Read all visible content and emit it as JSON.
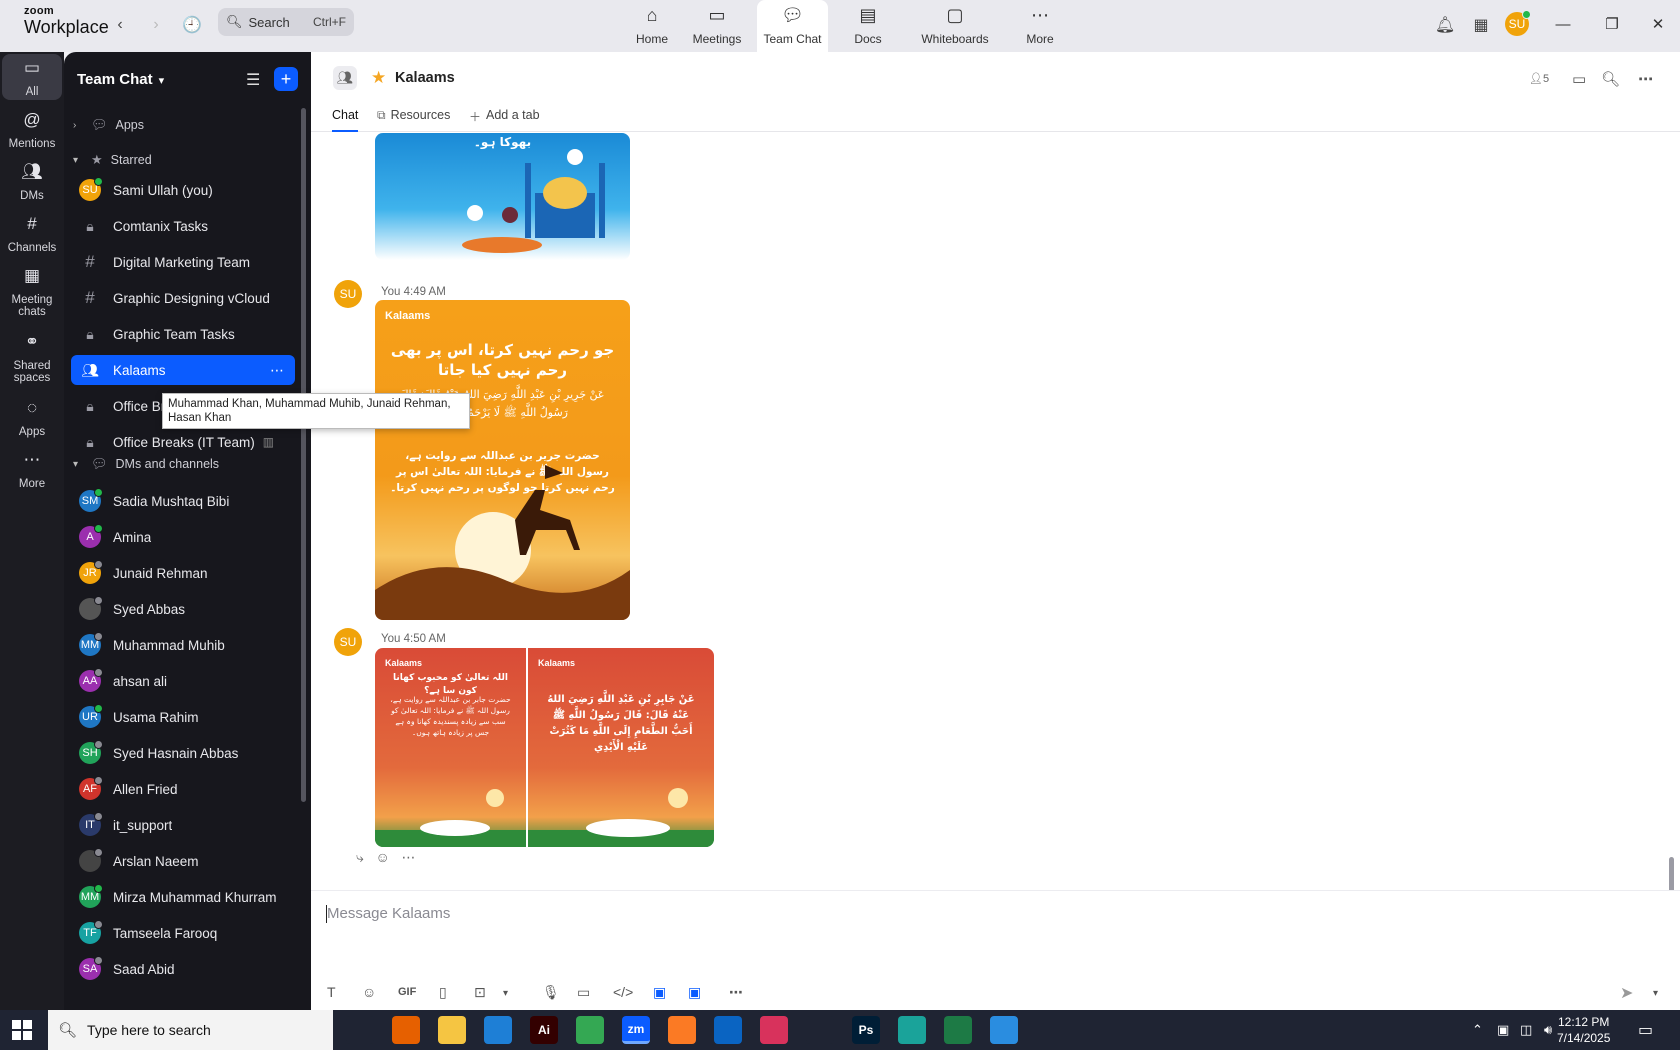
{
  "app": {
    "logo_line1": "zoom",
    "logo_line2": "Workplace",
    "search_placeholder": "Search",
    "search_shortcut": "Ctrl+F",
    "user_initials": "SU"
  },
  "nav_tabs": [
    {
      "label": "Home",
      "icon": "home-icon",
      "active": false
    },
    {
      "label": "Meetings",
      "icon": "video-icon",
      "active": false
    },
    {
      "label": "Team Chat",
      "icon": "chat-icon",
      "active": true
    },
    {
      "label": "Docs",
      "icon": "doc-icon",
      "active": false
    },
    {
      "label": "Whiteboards",
      "icon": "whiteboard-icon",
      "active": false
    },
    {
      "label": "More",
      "icon": "more-icon",
      "active": false
    }
  ],
  "rail": [
    {
      "label": "All",
      "icon": "chat-bubble-icon",
      "active": true
    },
    {
      "label": "Mentions",
      "icon": "at-icon"
    },
    {
      "label": "DMs",
      "icon": "people-icon"
    },
    {
      "label": "Channels",
      "icon": "hash-icon"
    },
    {
      "label": "Meeting chats",
      "icon": "calendar-icon"
    },
    {
      "label": "Shared spaces",
      "icon": "shared-icon"
    },
    {
      "label": "Apps",
      "icon": "apps-icon"
    },
    {
      "label": "More",
      "icon": "more-icon"
    }
  ],
  "sidebar": {
    "title": "Team Chat",
    "sections": {
      "apps": "Apps",
      "starred": "Starred",
      "dms": "DMs and channels"
    },
    "starred": [
      {
        "label": "Sami Ullah (you)",
        "kind": "avatar",
        "initials": "SU",
        "color": "#f0a30a",
        "status": "green"
      },
      {
        "label": "Comtanix Tasks",
        "kind": "lock"
      },
      {
        "label": "Digital Marketing Team",
        "kind": "hash"
      },
      {
        "label": "Graphic Designing vCloud",
        "kind": "hash"
      },
      {
        "label": "Graphic Team Tasks",
        "kind": "lock"
      },
      {
        "label": "Kalaams",
        "kind": "group",
        "selected": true
      },
      {
        "label": "Office Breaks",
        "kind": "lock"
      },
      {
        "label": "Office Breaks (IT Team)",
        "kind": "lock",
        "aux": "archive-icon"
      }
    ],
    "dms": [
      {
        "label": "Sadia Mushtaq Bibi",
        "initials": "SM",
        "color": "#1f77c4",
        "status": "green"
      },
      {
        "label": "Amina",
        "initials": "A",
        "color": "#9b2fae",
        "status": "green"
      },
      {
        "label": "Junaid Rehman",
        "initials": "JR",
        "color": "#f0a30a",
        "status": "grey"
      },
      {
        "label": "Syed Abbas",
        "initials": "",
        "color": "#555",
        "status": "grey"
      },
      {
        "label": "Muhammad Muhib",
        "initials": "MM",
        "color": "#1f77c4",
        "status": "grey"
      },
      {
        "label": "ahsan ali",
        "initials": "AA",
        "color": "#9b2fae",
        "status": "grey"
      },
      {
        "label": "Usama Rahim",
        "initials": "UR",
        "color": "#1f77c4",
        "status": "green"
      },
      {
        "label": "Syed Hasnain Abbas",
        "initials": "SH",
        "color": "#21a35a",
        "status": "grey"
      },
      {
        "label": "Allen Fried",
        "initials": "AF",
        "color": "#d0342c",
        "status": "grey"
      },
      {
        "label": "it_support",
        "initials": "IT",
        "color": "#2a3a6a",
        "status": "grey"
      },
      {
        "label": "Arslan Naeem",
        "initials": "",
        "color": "#444",
        "status": "grey"
      },
      {
        "label": "Mirza Muhammad Khurram",
        "initials": "MM",
        "color": "#21a35a",
        "status": "green"
      },
      {
        "label": "Tamseela Farooq",
        "initials": "TF",
        "color": "#17a2a2",
        "status": "grey"
      },
      {
        "label": "Saad Abid",
        "initials": "SA",
        "color": "#9b2fae",
        "status": "grey"
      }
    ],
    "tooltip": "Muhammad Khan, Muhammad Muhib, Junaid Rehman, Hasan Khan"
  },
  "channel": {
    "name": "Kalaams",
    "member_count": "5",
    "tabs": [
      "Chat",
      "Resources",
      "Add a tab"
    ]
  },
  "messages": [
    {
      "sender": "You",
      "time": "4:49 AM",
      "initials": "SU",
      "card_logo": "Kalaams",
      "card_arabic_1": "جو رحم نہیں کرتا، اس پر بھی رحم نہیں کیا جاتا",
      "card_arabic_2": "عَنْ جَرِيرِ بْنِ عَبْدِ اللَّهِ رَضِيَ اللهُ عَنْهُ قَالَ: قَالَ رَسُولُ اللَّهِ ﷺ لَا يَرْحَمُ النَّاسَ",
      "card_arabic_3": "حضرت جریر بن عبداللہ سے روایت ہے، رسول اللہ ﷺ نے فرمایا: اللہ تعالیٰ اس پر رحم نہیں کرتا جو لوگوں پر رحم نہیں کرتا۔"
    },
    {
      "sender": "You",
      "time": "4:50 AM",
      "initials": "SU",
      "card_logo": "Kalaams",
      "card_a_heading": "اللہ تعالیٰ کو محبوب کھانا کون سا ہے؟",
      "card_a_body": "حضرت جابر بن عبداللہ سے روایت ہے، رسول اللہ ﷺ نے فرمایا: اللہ تعالیٰ کو سب سے زیادہ پسندیدہ کھانا وہ ہے جس پر زیادہ ہاتھ ہوں۔",
      "card_b_body": "عَنْ جَابِرِ بْنِ عَبْدِ اللَّهِ رَضِيَ اللهُ عَنْهُ قَالَ: قَالَ رَسُولُ اللَّهِ ﷺ أَحَبُّ الطَّعَامِ إِلَى اللَّهِ مَا كَثُرَتْ عَلَيْهِ الْأَيْدِي"
    }
  ],
  "top_card_text": "بھوکا ہو۔",
  "composer": {
    "placeholder": "Message Kalaams",
    "gif_label": "GIF"
  },
  "taskbar": {
    "search_placeholder": "Type here to search",
    "time": "12:12 PM",
    "date": "7/14/2025",
    "apps": [
      {
        "name": "task-view",
        "label": "",
        "color": "#1f2433"
      },
      {
        "name": "firefox",
        "label": "",
        "color": "#e66000"
      },
      {
        "name": "file-explorer",
        "label": "",
        "color": "#f5c542"
      },
      {
        "name": "vscode",
        "label": "",
        "color": "#1e7fd6"
      },
      {
        "name": "illustrator",
        "label": "Ai",
        "color": "#300"
      },
      {
        "name": "chrome",
        "label": "",
        "color": "#34a853"
      },
      {
        "name": "zoom",
        "label": "zm",
        "color": "#0b5cff"
      },
      {
        "name": "xampp",
        "label": "",
        "color": "#fb7a24"
      },
      {
        "name": "outlook",
        "label": "",
        "color": "#0a64c2"
      },
      {
        "name": "creative-cloud",
        "label": "",
        "color": "#d8325c"
      },
      {
        "name": "pen-tool",
        "label": "",
        "color": "#1f2433"
      },
      {
        "name": "photoshop",
        "label": "Ps",
        "color": "#001e36"
      },
      {
        "name": "app-blue",
        "label": "",
        "color": "#1aa39a"
      },
      {
        "name": "excel",
        "label": "",
        "color": "#1d7a45"
      },
      {
        "name": "paint",
        "label": "",
        "color": "#2a8de0"
      }
    ]
  }
}
